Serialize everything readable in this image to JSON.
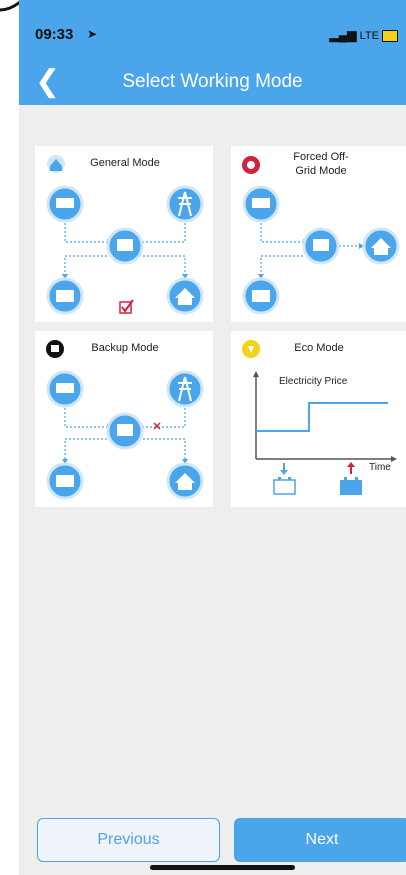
{
  "status": {
    "time": "09:33",
    "network": "LTE"
  },
  "nav": {
    "title": "Select Working Mode"
  },
  "cards": {
    "general": {
      "title": "General Mode"
    },
    "forced": {
      "title_line1": "Forced Off-",
      "title_line2": "Grid Mode"
    },
    "backup": {
      "title": "Backup Mode"
    },
    "eco": {
      "title": "Eco Mode",
      "price_label": "Electricity Price",
      "time_label": "Time"
    }
  },
  "buttons": {
    "previous": "Previous",
    "next": "Next"
  },
  "colors": {
    "accent": "#4aa5ea",
    "check": "#d0243c",
    "arrow_down": "#4aa5ea",
    "arrow_up": "#d0243c"
  }
}
